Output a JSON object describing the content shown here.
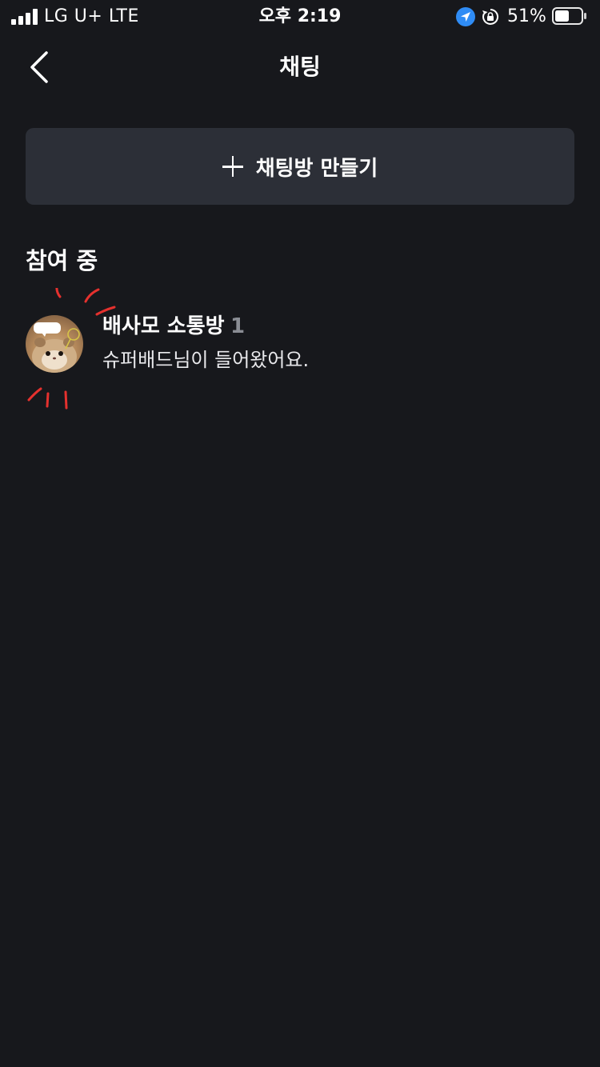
{
  "status_bar": {
    "carrier": "LG U+   LTE",
    "time": "오후 2:19",
    "battery": "51%"
  },
  "nav": {
    "title": "채팅",
    "back_icon": "chevron-left-icon"
  },
  "create_room": {
    "label": "채팅방 만들기",
    "icon": "plus-icon"
  },
  "section": {
    "title": "참여 중"
  },
  "rooms": [
    {
      "name": "배사모 소통방",
      "member_count": "1",
      "last_message": "슈퍼배드님이 들어왔어요.",
      "avatar": "hamster-avatar",
      "avatar_caption": "..."
    }
  ],
  "colors": {
    "background": "#17181c",
    "button_bg": "#2c2f37",
    "muted": "#8a8d94",
    "annotation_red": "#e5312e",
    "location_blue": "#2f8cf5"
  }
}
